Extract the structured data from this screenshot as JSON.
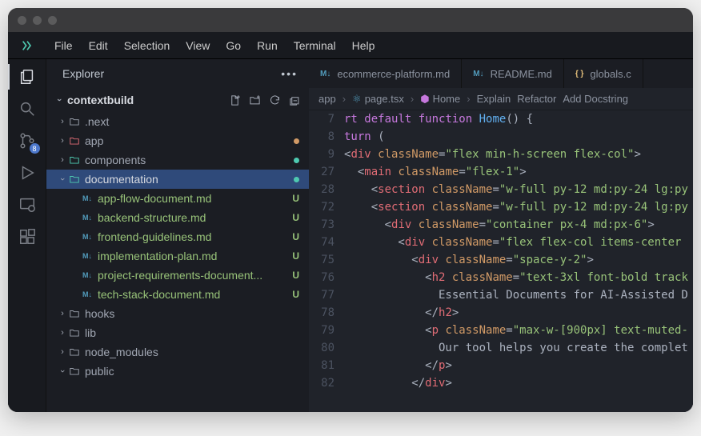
{
  "menu": {
    "items": [
      "File",
      "Edit",
      "Selection",
      "View",
      "Go",
      "Run",
      "Terminal",
      "Help"
    ]
  },
  "scm_badge": "8",
  "sidebar": {
    "title": "Explorer",
    "project": "contextbuild",
    "tree": [
      {
        "kind": "folder",
        "name": ".next",
        "depth": 0,
        "open": false,
        "color": "folder-ico",
        "status": ""
      },
      {
        "kind": "folder",
        "name": "app",
        "depth": 0,
        "open": false,
        "color": "folder-app",
        "status": "dot-orange"
      },
      {
        "kind": "folder",
        "name": "components",
        "depth": 0,
        "open": false,
        "color": "folder-comp",
        "status": "dot-teal"
      },
      {
        "kind": "folder",
        "name": "documentation",
        "depth": 0,
        "open": true,
        "color": "folder-doc",
        "status": "dot-teal",
        "selected": true
      },
      {
        "kind": "file",
        "name": "app-flow-document.md",
        "depth": 1,
        "badge": "U",
        "green": true
      },
      {
        "kind": "file",
        "name": "backend-structure.md",
        "depth": 1,
        "badge": "U",
        "green": true
      },
      {
        "kind": "file",
        "name": "frontend-guidelines.md",
        "depth": 1,
        "badge": "U",
        "green": true
      },
      {
        "kind": "file",
        "name": "implementation-plan.md",
        "depth": 1,
        "badge": "U",
        "green": true
      },
      {
        "kind": "file",
        "name": "project-requirements-document...",
        "depth": 1,
        "badge": "U",
        "green": true
      },
      {
        "kind": "file",
        "name": "tech-stack-document.md",
        "depth": 1,
        "badge": "U",
        "green": true
      },
      {
        "kind": "folder",
        "name": "hooks",
        "depth": 0,
        "open": false,
        "color": "folder-ico",
        "status": ""
      },
      {
        "kind": "folder",
        "name": "lib",
        "depth": 0,
        "open": false,
        "color": "folder-ico",
        "status": ""
      },
      {
        "kind": "folder",
        "name": "node_modules",
        "depth": 0,
        "open": false,
        "color": "folder-ico",
        "status": ""
      },
      {
        "kind": "folder",
        "name": "public",
        "depth": 0,
        "open": true,
        "color": "folder-ico",
        "status": ""
      }
    ]
  },
  "tabs": [
    {
      "label": "ecommerce-platform.md",
      "icon": "M↓",
      "iconClass": "tab-md"
    },
    {
      "label": "README.md",
      "icon": "M↓",
      "iconClass": "tab-md"
    },
    {
      "label": "globals.c",
      "icon": "{ }",
      "iconClass": "tab-css"
    }
  ],
  "breadcrumb": {
    "parts": [
      "app",
      "page.tsx",
      "Home"
    ],
    "actions": [
      "Explain",
      "Refactor",
      "Add Docstring"
    ]
  },
  "code": {
    "line_numbers": [
      "7",
      "8",
      "9",
      "27",
      "28",
      "72",
      "73",
      "74",
      "75",
      "76",
      "77",
      "78",
      "79",
      "80",
      "81",
      "82"
    ],
    "lines": [
      [
        {
          "c": "tok-k",
          "t": "rt "
        },
        {
          "c": "tok-k",
          "t": "default "
        },
        {
          "c": "tok-k",
          "t": "function "
        },
        {
          "c": "tok-fn",
          "t": "Home"
        },
        {
          "c": "tok-punc",
          "t": "() {"
        }
      ],
      [
        {
          "c": "tok-k",
          "t": "turn "
        },
        {
          "c": "tok-punc",
          "t": "("
        }
      ],
      [
        {
          "c": "tok-punc",
          "t": "<"
        },
        {
          "c": "tok-tag",
          "t": "div "
        },
        {
          "c": "tok-attr",
          "t": "className"
        },
        {
          "c": "tok-punc",
          "t": "="
        },
        {
          "c": "tok-str",
          "t": "\"flex min-h-screen flex-col\""
        },
        {
          "c": "tok-punc",
          "t": ">"
        }
      ],
      [
        {
          "c": "tok-punc",
          "t": "  <"
        },
        {
          "c": "tok-tag",
          "t": "main "
        },
        {
          "c": "tok-attr",
          "t": "className"
        },
        {
          "c": "tok-punc",
          "t": "="
        },
        {
          "c": "tok-str",
          "t": "\"flex-1\""
        },
        {
          "c": "tok-punc",
          "t": ">"
        }
      ],
      [
        {
          "c": "tok-punc",
          "t": "    <"
        },
        {
          "c": "tok-tag",
          "t": "section "
        },
        {
          "c": "tok-attr",
          "t": "className"
        },
        {
          "c": "tok-punc",
          "t": "="
        },
        {
          "c": "tok-str",
          "t": "\"w-full py-12 md:py-24 lg:py"
        }
      ],
      [
        {
          "c": "tok-punc",
          "t": "    <"
        },
        {
          "c": "tok-tag",
          "t": "section "
        },
        {
          "c": "tok-attr",
          "t": "className"
        },
        {
          "c": "tok-punc",
          "t": "="
        },
        {
          "c": "tok-str",
          "t": "\"w-full py-12 md:py-24 lg:py"
        }
      ],
      [
        {
          "c": "tok-punc",
          "t": "      <"
        },
        {
          "c": "tok-tag",
          "t": "div "
        },
        {
          "c": "tok-attr",
          "t": "className"
        },
        {
          "c": "tok-punc",
          "t": "="
        },
        {
          "c": "tok-str",
          "t": "\"container px-4 md:px-6\""
        },
        {
          "c": "tok-punc",
          "t": ">"
        }
      ],
      [
        {
          "c": "tok-punc",
          "t": "        <"
        },
        {
          "c": "tok-tag",
          "t": "div "
        },
        {
          "c": "tok-attr",
          "t": "className"
        },
        {
          "c": "tok-punc",
          "t": "="
        },
        {
          "c": "tok-str",
          "t": "\"flex flex-col items-center "
        }
      ],
      [
        {
          "c": "tok-punc",
          "t": "          <"
        },
        {
          "c": "tok-tag",
          "t": "div "
        },
        {
          "c": "tok-attr",
          "t": "className"
        },
        {
          "c": "tok-punc",
          "t": "="
        },
        {
          "c": "tok-str",
          "t": "\"space-y-2\""
        },
        {
          "c": "tok-punc",
          "t": ">"
        }
      ],
      [
        {
          "c": "tok-punc",
          "t": "            <"
        },
        {
          "c": "tok-tag",
          "t": "h2 "
        },
        {
          "c": "tok-attr",
          "t": "className"
        },
        {
          "c": "tok-punc",
          "t": "="
        },
        {
          "c": "tok-str",
          "t": "\"text-3xl font-bold track"
        }
      ],
      [
        {
          "c": "tok-text",
          "t": "              Essential Documents for AI-Assisted D"
        }
      ],
      [
        {
          "c": "tok-punc",
          "t": "            </"
        },
        {
          "c": "tok-tag",
          "t": "h2"
        },
        {
          "c": "tok-punc",
          "t": ">"
        }
      ],
      [
        {
          "c": "tok-punc",
          "t": "            <"
        },
        {
          "c": "tok-tag",
          "t": "p "
        },
        {
          "c": "tok-attr",
          "t": "className"
        },
        {
          "c": "tok-punc",
          "t": "="
        },
        {
          "c": "tok-str",
          "t": "\"max-w-[900px] text-muted-"
        }
      ],
      [
        {
          "c": "tok-text",
          "t": "              Our tool helps you create the complet"
        }
      ],
      [
        {
          "c": "tok-punc",
          "t": "            </"
        },
        {
          "c": "tok-tag",
          "t": "p"
        },
        {
          "c": "tok-punc",
          "t": ">"
        }
      ],
      [
        {
          "c": "tok-punc",
          "t": "          </"
        },
        {
          "c": "tok-tag",
          "t": "div"
        },
        {
          "c": "tok-punc",
          "t": ">"
        }
      ]
    ]
  }
}
